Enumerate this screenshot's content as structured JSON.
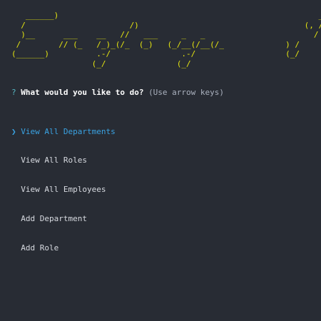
{
  "banner": {
    "lines": [
      "   ______)                                                       _____",
      "  /                      /)                                   (, /    )",
      "  )__      ___    __   //   ___     _   _                       /     /",
      " /        // (_   /_)_(/_  (_)   (_/__(/__(/_             ) /      ",
      "(______)          .-/               .-/                   (_/",
      "                 (_/               (_/"
    ]
  },
  "prompt": {
    "marker": "?",
    "question": "What would you like to do?",
    "hint": "(Use arrow keys)"
  },
  "menu": {
    "pointer": "❯",
    "items": [
      {
        "label": "View All Departments",
        "selected": true
      },
      {
        "label": "View All Roles",
        "selected": false
      },
      {
        "label": "View All Employees",
        "selected": false
      },
      {
        "label": "Add Department",
        "selected": false
      },
      {
        "label": "Add Role",
        "selected": false
      }
    ]
  },
  "colors": {
    "background": "#282c34",
    "banner": "#e5e510",
    "selected": "#3aa3e3",
    "marker": "#56b6c2"
  }
}
